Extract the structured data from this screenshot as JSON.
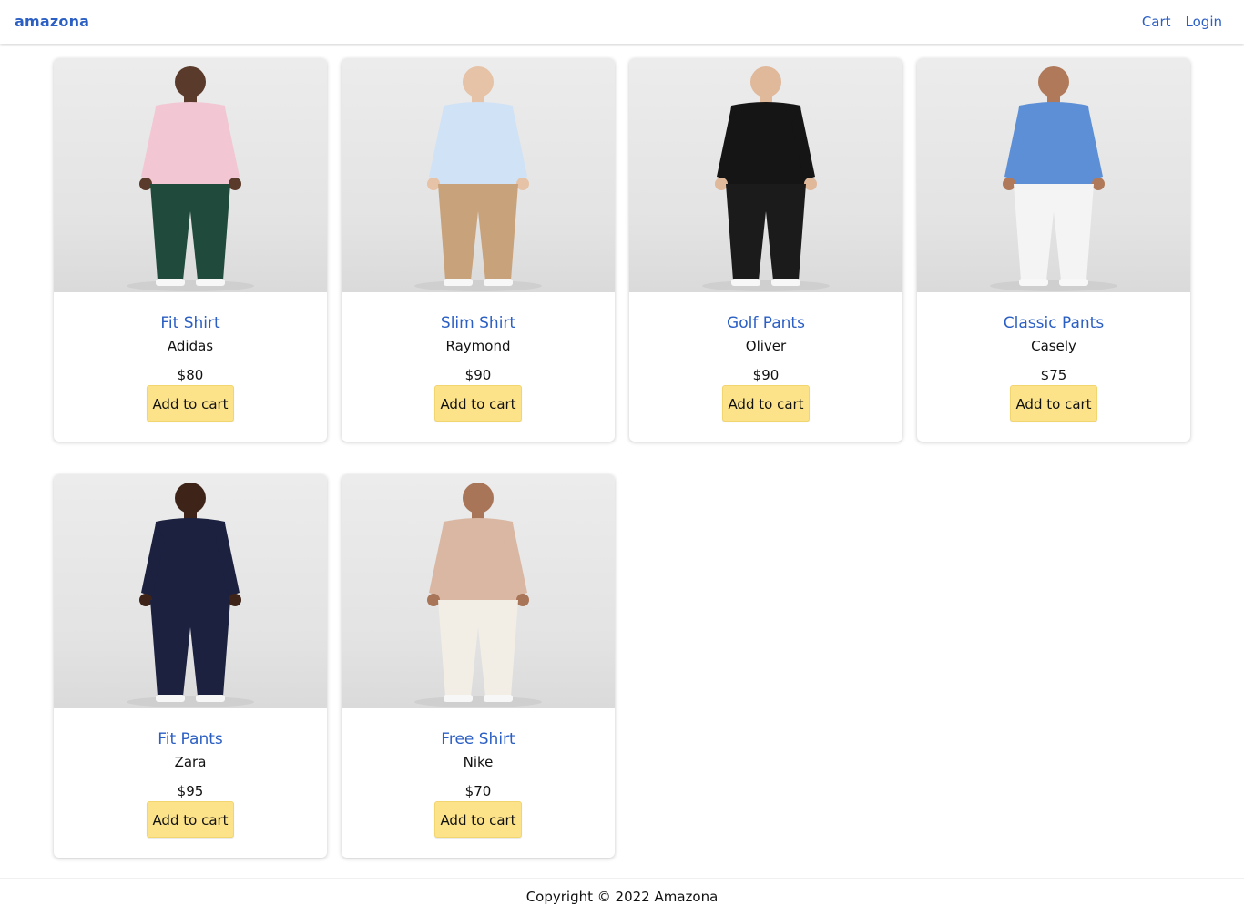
{
  "header": {
    "brand": "amazona",
    "nav": {
      "cart": "Cart",
      "login": "Login"
    }
  },
  "products": [
    {
      "name": "Fit Shirt",
      "brand": "Adidas",
      "price": "$80",
      "button": "Add to cart",
      "shirt_color": "#f2c6d3",
      "pants_color": "#1f4a3c",
      "skin_color": "#5a3a2a"
    },
    {
      "name": "Slim Shirt",
      "brand": "Raymond",
      "price": "$90",
      "button": "Add to cart",
      "shirt_color": "#cfe2f6",
      "pants_color": "#c8a27a",
      "skin_color": "#e6c2a6"
    },
    {
      "name": "Golf Pants",
      "brand": "Oliver",
      "price": "$90",
      "button": "Add to cart",
      "shirt_color": "#151515",
      "pants_color": "#1b1b1b",
      "skin_color": "#e0b89a"
    },
    {
      "name": "Classic Pants",
      "brand": "Casely",
      "price": "$75",
      "button": "Add to cart",
      "shirt_color": "#5c8fd6",
      "pants_color": "#f4f4f4",
      "skin_color": "#b07a5a"
    },
    {
      "name": "Fit Pants",
      "brand": "Zara",
      "price": "$95",
      "button": "Add to cart",
      "shirt_color": "#1c2140",
      "pants_color": "#1c2140",
      "skin_color": "#3e2418"
    },
    {
      "name": "Free Shirt",
      "brand": "Nike",
      "price": "$70",
      "button": "Add to cart",
      "shirt_color": "#d9b7a3",
      "pants_color": "#f2eee6",
      "skin_color": "#a97558"
    }
  ],
  "footer": {
    "text": "Copyright © 2022 Amazona"
  }
}
